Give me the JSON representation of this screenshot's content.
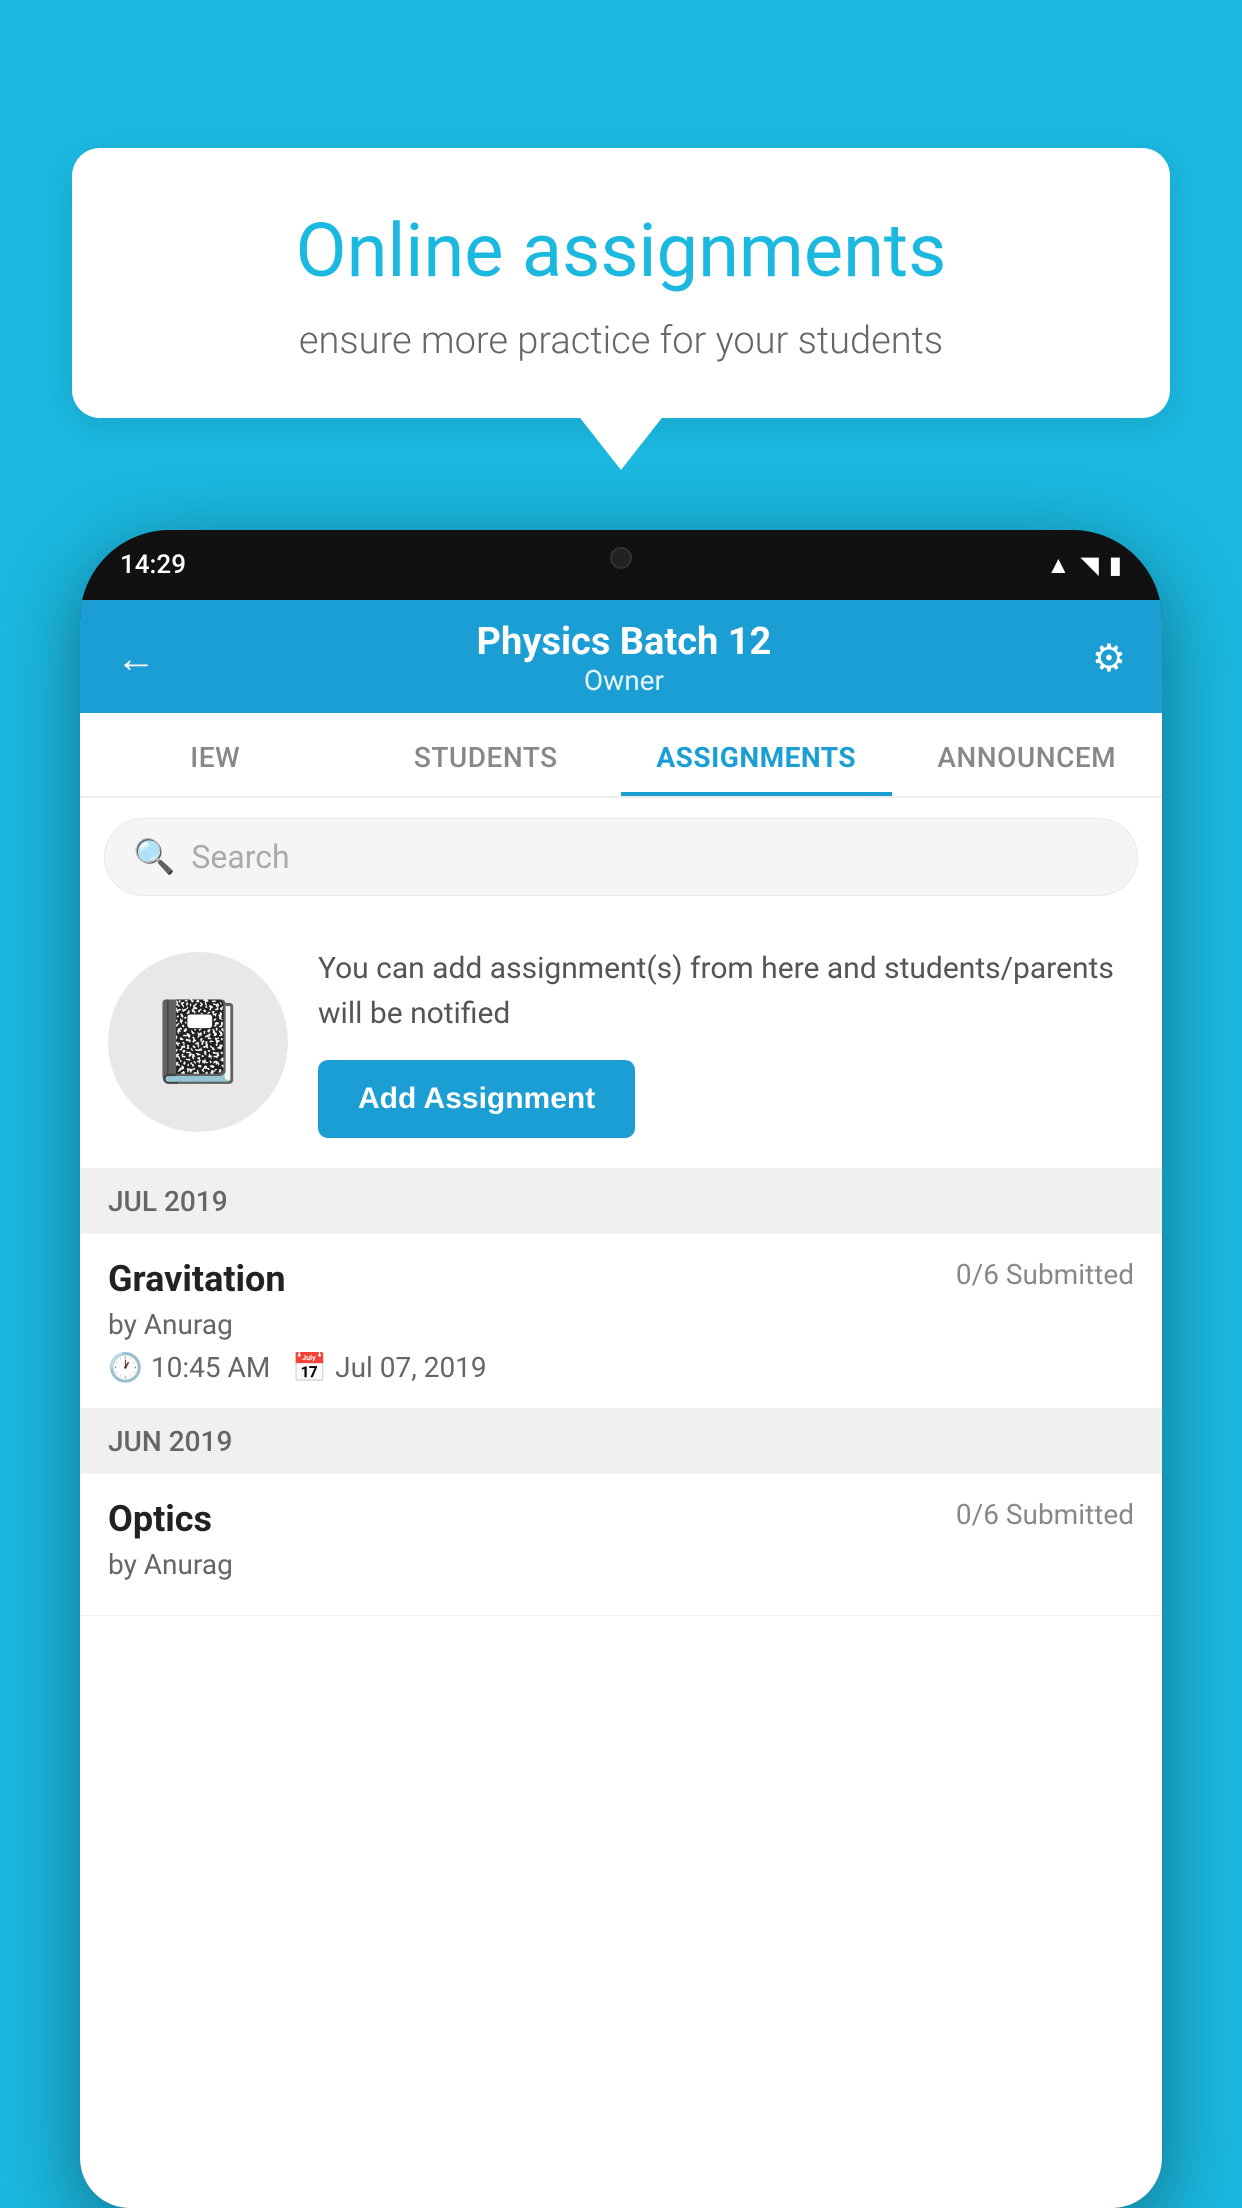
{
  "background_color": "#1bb8e0",
  "speech_bubble": {
    "title": "Online assignments",
    "subtitle": "ensure more practice for your students"
  },
  "phone": {
    "time": "14:29",
    "header": {
      "title": "Physics Batch 12",
      "subtitle": "Owner",
      "back_label": "←",
      "settings_label": "⚙"
    },
    "tabs": [
      {
        "label": "IEW",
        "active": false
      },
      {
        "label": "STUDENTS",
        "active": false
      },
      {
        "label": "ASSIGNMENTS",
        "active": true
      },
      {
        "label": "ANNOUNCEM",
        "active": false
      }
    ],
    "search": {
      "placeholder": "Search"
    },
    "info_section": {
      "description": "You can add assignment(s) from here and students/parents will be notified",
      "button_label": "Add Assignment"
    },
    "sections": [
      {
        "label": "JUL 2019",
        "items": [
          {
            "title": "Gravitation",
            "submitted": "0/6 Submitted",
            "author": "by Anurag",
            "time": "10:45 AM",
            "date": "Jul 07, 2019"
          }
        ]
      },
      {
        "label": "JUN 2019",
        "items": [
          {
            "title": "Optics",
            "submitted": "0/6 Submitted",
            "author": "by Anurag",
            "time": "",
            "date": ""
          }
        ]
      }
    ]
  }
}
